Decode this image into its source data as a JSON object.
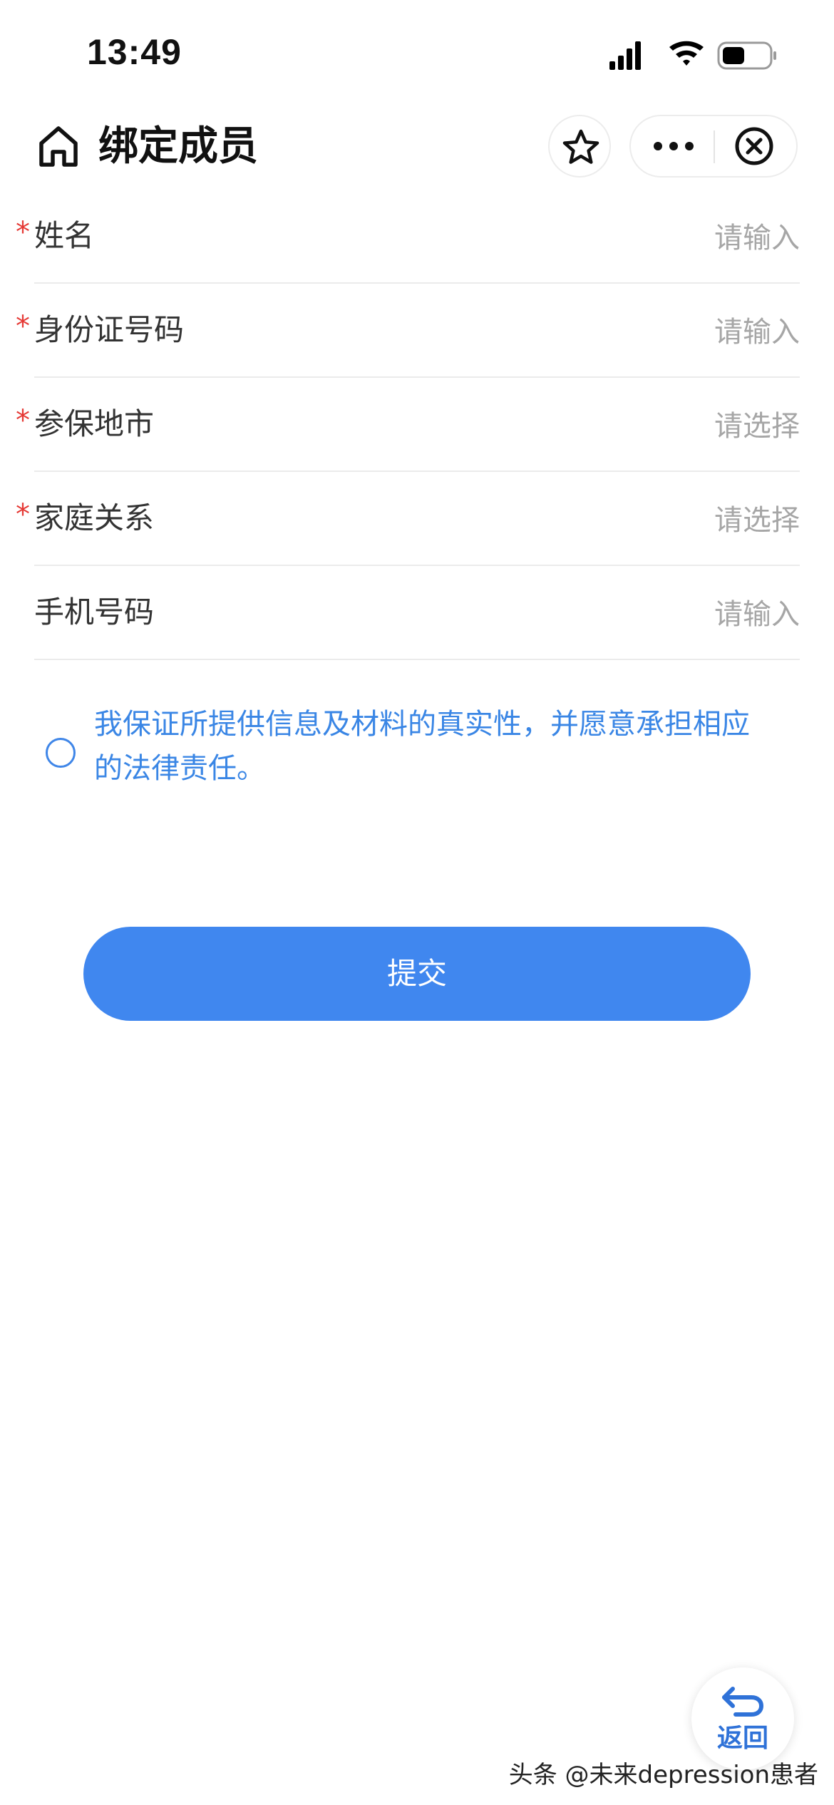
{
  "status_bar": {
    "time": "13:49"
  },
  "nav": {
    "title": "绑定成员",
    "icons": [
      "home-icon",
      "star-icon",
      "more-icon",
      "close-circle-icon"
    ]
  },
  "form": {
    "fields": [
      {
        "label": "姓名",
        "required": "*",
        "value": "请输入"
      },
      {
        "label": "身份证号码",
        "required": "*",
        "value": "请输入"
      },
      {
        "label": "参保地市",
        "required": "*",
        "value": "请选择"
      },
      {
        "label": "家庭关系",
        "required": "*",
        "value": "请选择"
      },
      {
        "label": "手机号码",
        "required": "",
        "value": "请输入"
      }
    ]
  },
  "agreement": {
    "text": "我保证所提供信息及材料的真实性，并愿意承担相应的法律责任。",
    "checked": false
  },
  "submit": {
    "label": "提交"
  },
  "back": {
    "label": "返回"
  },
  "watermark": {
    "text": "头条 @未来depression患者"
  },
  "colors": {
    "primary": "#4087ef",
    "link_text": "#3a86e5",
    "required": "#e53935",
    "placeholder": "#a6a6a6",
    "divider": "#ebebeb"
  }
}
